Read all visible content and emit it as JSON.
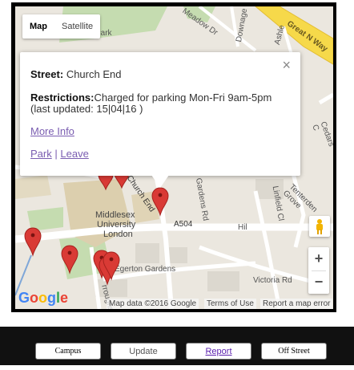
{
  "map": {
    "type_controls": {
      "map_label": "Map",
      "satellite_label": "Satellite"
    },
    "labels": {
      "meadow": "Meadow Dr",
      "downage": "Downage",
      "great_n_way": "Great N Way",
      "ashley": "Ashle",
      "park": "Park",
      "church_end": "Church End",
      "gardens_rd": "Gardens Rd",
      "university_1": "Middlesex",
      "university_2": "University",
      "university_3": "London",
      "a504": "A504",
      "linfield": "Linfield Cl",
      "tenterden": "Tenterden Grove",
      "cedars": "Cedars C",
      "egerton": "Egerton Gardens",
      "victoria": "Victoria Rd",
      "burroughs": "rroughs",
      "hil": "Hil"
    },
    "google_logo": "Google",
    "attribution": {
      "map_data": "Map data ©2016 Google",
      "terms": "Terms of Use",
      "report": "Report a map error"
    },
    "zoom": {
      "plus": "+",
      "minus": "−"
    }
  },
  "popup": {
    "street_label": "Street:",
    "street_value": "Church End",
    "restrictions_label": "Restrictions:",
    "restrictions_value": "Charged for parking Mon-Fri 9am-5pm",
    "updated": "(last updated: 15|04|16 )",
    "more_info": "More Info",
    "park": "Park",
    "separator": "|",
    "leave": "Leave",
    "close": "×"
  },
  "buttons": {
    "campus": "Campus",
    "update": "Update",
    "report": "Report",
    "off_street": "Off Street"
  },
  "colors": {
    "marker": "#d93a35",
    "road_yellow": "#f6d94a",
    "link": "#7a5db1"
  }
}
